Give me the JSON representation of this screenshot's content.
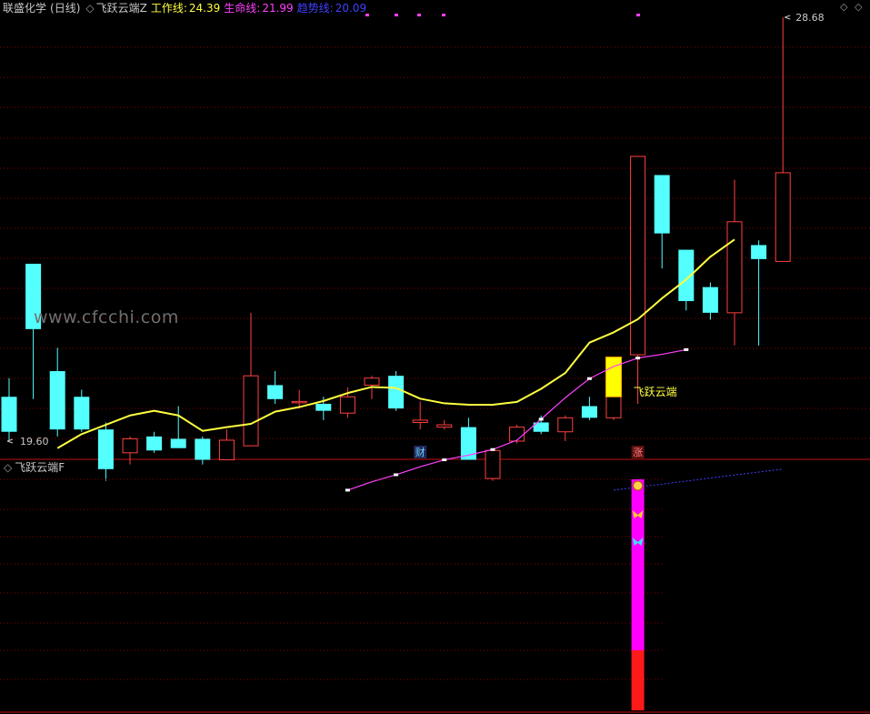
{
  "header": {
    "stock_name": "联盛化学",
    "period": "(日线)",
    "indicator_name": "飞跃云端Z",
    "work_line_label": "工作线:",
    "work_line_value": "24.39",
    "life_line_label": "生命线:",
    "life_line_value": "21.99",
    "trend_line_label": "趋势线:",
    "trend_line_value": "20.09"
  },
  "controls": {
    "diamond_small": "◇",
    "diamond_large": "◇"
  },
  "watermark": "www.cfcchi.com",
  "sub_panel": {
    "title": "飞跃云端F"
  },
  "colors": {
    "up": "#ff4040",
    "down": "#54ffff",
    "work_line": "#ffff40",
    "life_line": "#ff40ff",
    "trend_line": "#4040ff",
    "grid": "#8a0000",
    "signal_up": "#ff1a1a",
    "signal_mid": "#ff00ff"
  },
  "chart_data": {
    "type": "candlestick",
    "price_range": [
      19.2,
      29.3
    ],
    "highest_label": "28.68",
    "lowest_label": "19.60",
    "candles": [
      {
        "o": 20.55,
        "c": 19.8,
        "h": 20.95,
        "l": 19.6
      },
      {
        "o": 23.4,
        "c": 22.0,
        "h": 23.4,
        "l": 20.5
      },
      {
        "o": 21.1,
        "c": 19.85,
        "h": 21.6,
        "l": 19.7
      },
      {
        "o": 20.55,
        "c": 19.85,
        "h": 20.7,
        "l": 19.8
      },
      {
        "o": 19.85,
        "c": 19.0,
        "h": 20.0,
        "l": 18.75
      },
      {
        "o": 19.35,
        "c": 19.65,
        "h": 19.7,
        "l": 19.1
      },
      {
        "o": 19.7,
        "c": 19.4,
        "h": 19.8,
        "l": 19.35
      },
      {
        "o": 19.65,
        "c": 19.45,
        "h": 20.35,
        "l": 19.45
      },
      {
        "o": 19.65,
        "c": 19.2,
        "h": 19.7,
        "l": 19.1
      },
      {
        "o": 19.2,
        "c": 19.62,
        "h": 19.85,
        "l": 19.2
      },
      {
        "o": 19.5,
        "c": 21.0,
        "h": 22.35,
        "l": 19.5
      },
      {
        "o": 20.8,
        "c": 20.5,
        "h": 21.1,
        "l": 20.4
      },
      {
        "o": 20.45,
        "c": 20.45,
        "h": 20.7,
        "l": 20.3
      },
      {
        "o": 20.4,
        "c": 20.25,
        "h": 20.55,
        "l": 20.05
      },
      {
        "o": 20.2,
        "c": 20.55,
        "h": 20.75,
        "l": 20.1
      },
      {
        "o": 20.8,
        "c": 20.95,
        "h": 21.0,
        "l": 20.5
      },
      {
        "o": 21.0,
        "c": 20.3,
        "h": 21.1,
        "l": 20.25
      },
      {
        "o": 20.0,
        "c": 20.05,
        "h": 20.45,
        "l": 19.85
      },
      {
        "o": 19.9,
        "c": 19.95,
        "h": 20.05,
        "l": 19.85
      },
      {
        "o": 19.9,
        "c": 19.2,
        "h": 20.1,
        "l": 19.2
      },
      {
        "o": 18.8,
        "c": 19.4,
        "h": 19.4,
        "l": 18.75
      },
      {
        "o": 19.6,
        "c": 19.9,
        "h": 19.95,
        "l": 19.55
      },
      {
        "o": 20.0,
        "c": 19.8,
        "h": 20.15,
        "l": 19.75
      },
      {
        "o": 19.8,
        "c": 20.1,
        "h": 20.15,
        "l": 19.6
      },
      {
        "o": 20.35,
        "c": 20.1,
        "h": 20.55,
        "l": 20.05
      },
      {
        "o": 20.1,
        "c": 20.8,
        "h": 20.8,
        "l": 20.05
      },
      {
        "o": 21.45,
        "c": 25.7,
        "h": 25.7,
        "l": 20.4
      },
      {
        "o": 25.3,
        "c": 24.05,
        "h": 25.3,
        "l": 23.3
      },
      {
        "o": 23.7,
        "c": 22.6,
        "h": 23.7,
        "l": 22.4
      },
      {
        "o": 22.9,
        "c": 22.35,
        "h": 23.0,
        "l": 22.2
      },
      {
        "o": 22.35,
        "c": 24.3,
        "h": 25.2,
        "l": 21.65
      },
      {
        "o": 23.8,
        "c": 23.5,
        "h": 23.9,
        "l": 21.65
      },
      {
        "o": 23.45,
        "c": 25.35,
        "h": 28.68,
        "l": 23.45
      }
    ],
    "work_line": [
      19.45,
      19.75,
      19.95,
      20.15,
      20.25,
      20.15,
      19.82,
      19.9,
      19.97,
      20.23,
      20.33,
      20.46,
      20.63,
      20.76,
      20.74,
      20.51,
      20.41,
      20.38,
      20.38,
      20.44,
      20.72,
      21.06,
      21.71,
      21.93,
      22.21,
      22.66,
      23.06,
      23.55,
      23.92
    ],
    "work_line_start_index": 2,
    "life_line": [
      18.55,
      18.73,
      18.88,
      19.05,
      19.2,
      19.3,
      19.42,
      19.62,
      20.07,
      20.53,
      20.94,
      21.2,
      21.38,
      21.46,
      21.56
    ],
    "life_line_start_index": 14,
    "trend_line": [
      18.55,
      19.0
    ],
    "trend_line_start_index": 25,
    "signals": [
      {
        "index": 17,
        "label": "财"
      },
      {
        "index": 26,
        "label": "涨"
      }
    ],
    "annotation": {
      "index": 26,
      "text": "飞跃云端"
    }
  }
}
